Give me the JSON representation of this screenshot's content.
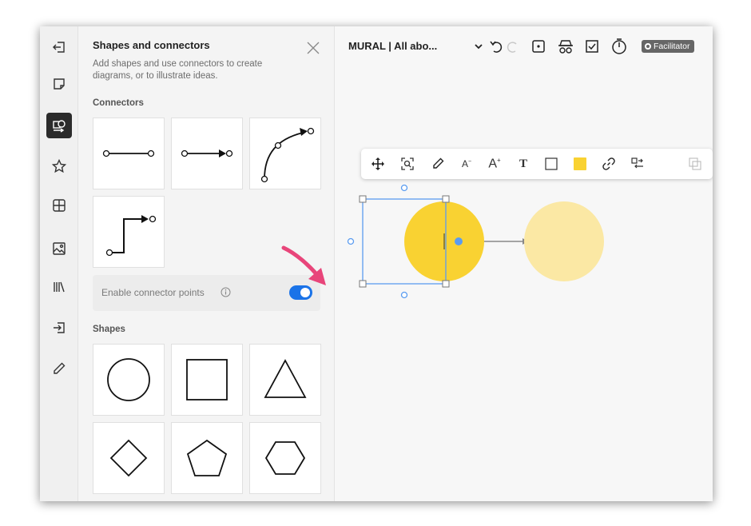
{
  "rail": {
    "items": [
      {
        "name": "collapse-icon",
        "active": false
      },
      {
        "name": "sticky-note-icon",
        "active": false
      },
      {
        "name": "shapes-icon",
        "active": true
      },
      {
        "name": "star-icon",
        "active": false
      },
      {
        "name": "grid-icon",
        "active": false
      },
      {
        "name": "image-icon",
        "active": false
      },
      {
        "name": "library-icon",
        "active": false
      },
      {
        "name": "import-icon",
        "active": false
      },
      {
        "name": "pencil-icon",
        "active": false
      }
    ]
  },
  "panel": {
    "title": "Shapes and connectors",
    "description": "Add shapes and use connectors to create diagrams, or to illustrate ideas.",
    "connectors_label": "Connectors",
    "connectors": [
      "straight-line-connector",
      "arrow-connector",
      "curved-connector",
      "elbow-connector"
    ],
    "toggle_label": "Enable connector points",
    "toggle_on": true,
    "shapes_label": "Shapes",
    "shapes": [
      "circle",
      "square",
      "triangle",
      "diamond",
      "pentagon",
      "hexagon"
    ]
  },
  "topbar": {
    "title": "MURAL | All abo...",
    "icons": [
      "chevron-down-icon",
      "undo-icon",
      "redo-icon",
      "dice-icon",
      "incognito-icon",
      "checklist-icon",
      "timer-icon"
    ],
    "facilitator_label": "Facilitator"
  },
  "toolbar": {
    "font_decrease": "A",
    "font_decrease_sup": "−",
    "font_increase": "A",
    "font_increase_sup": "+",
    "text_tool": "T",
    "fill_color": "#f9d232"
  },
  "colors": {
    "accent": "#1a73e8",
    "selection": "#5b9cf0",
    "annotation_arrow": "#e8457a",
    "shape_fill_primary": "#f9d232",
    "shape_fill_secondary": "#fbe8a4"
  }
}
